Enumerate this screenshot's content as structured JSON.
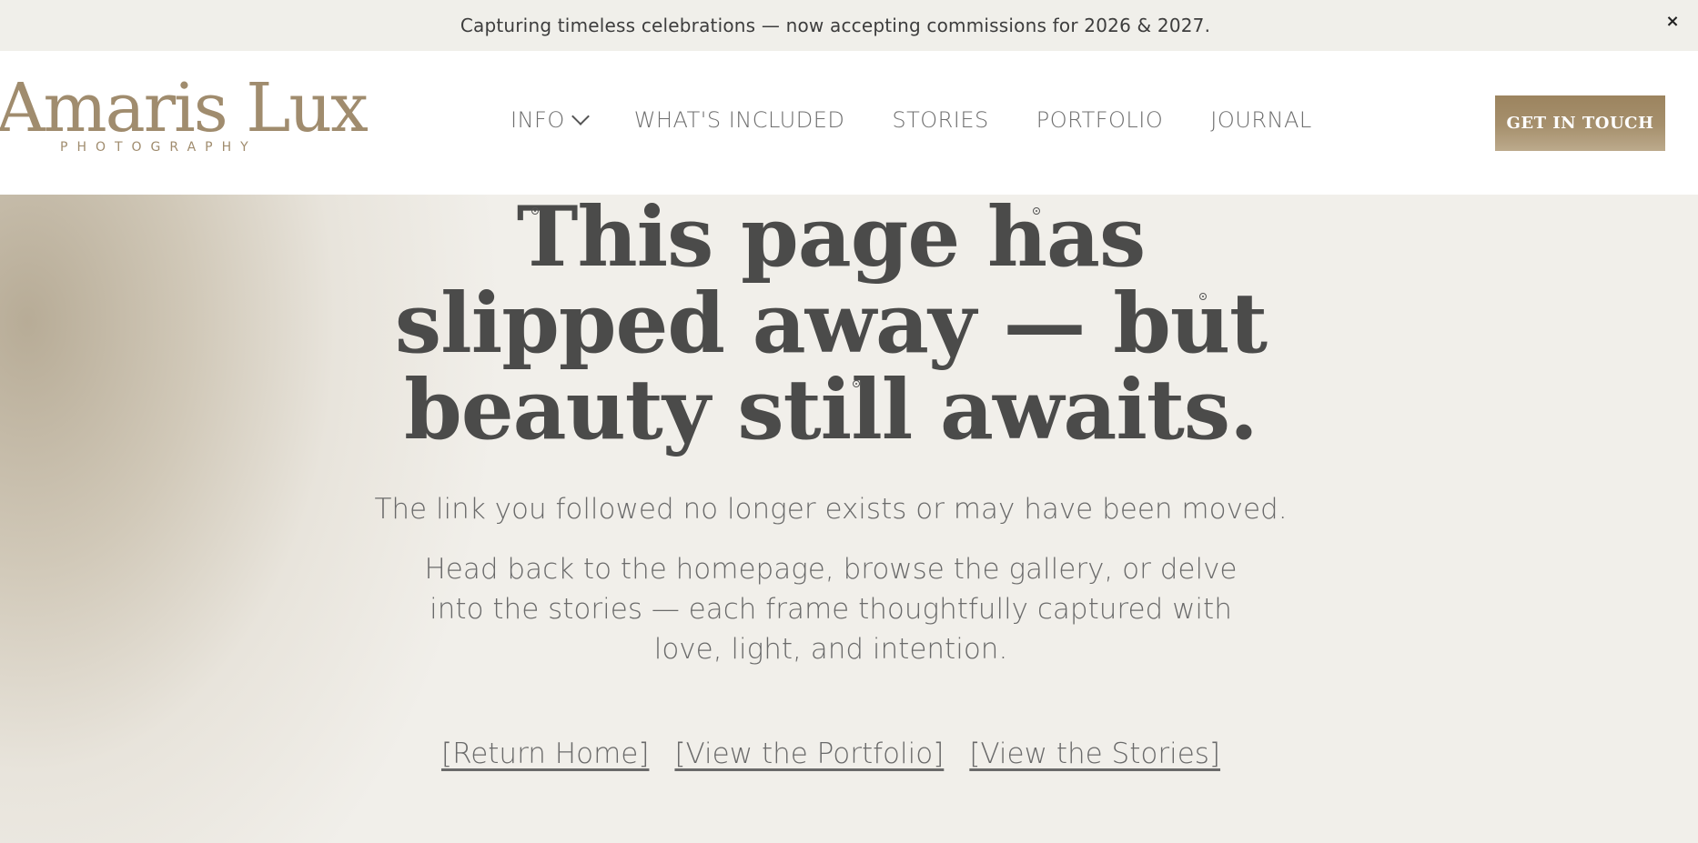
{
  "announcement": {
    "text": "Capturing timeless celebrations — now accepting commissions for 2026 & 2027.",
    "close_label": "×"
  },
  "header": {
    "logo": {
      "main": "Amaris Lux",
      "sub": "PHOTOGRAPHY"
    },
    "nav": [
      {
        "label": "INFO",
        "has_dropdown": true
      },
      {
        "label": "WHAT'S INCLUDED"
      },
      {
        "label": "STORIES"
      },
      {
        "label": "PORTFOLIO"
      },
      {
        "label": "JOURNAL"
      }
    ],
    "cta_label": "GET IN TOUCH"
  },
  "main": {
    "headline": "This page has slipped away — but beauty still awaits.",
    "message": "The link you followed no longer exists or may have been moved.",
    "description": "Head back to the homepage, browse the gallery, or delve into the stories — each frame thoughtfully captured with love, light, and intention.",
    "links": [
      "[Return Home]",
      "[View the Portfolio]",
      "[View the Stories]"
    ]
  },
  "colors": {
    "brand_gold": "#a08c6e",
    "cta_gold": "#9c845f",
    "background": "#f1efea",
    "text_dark": "#4b4b4a",
    "text_muted": "#6a6a6a"
  }
}
